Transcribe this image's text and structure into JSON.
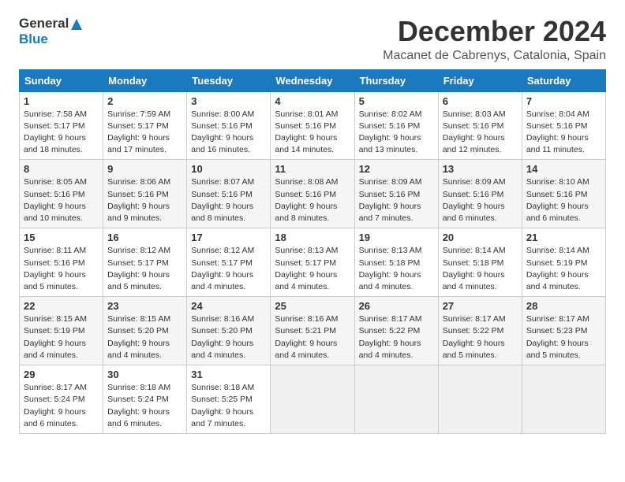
{
  "logo": {
    "line1": "General",
    "line2": "Blue"
  },
  "title": "December 2024",
  "subtitle": "Macanet de Cabrenys, Catalonia, Spain",
  "days_of_week": [
    "Sunday",
    "Monday",
    "Tuesday",
    "Wednesday",
    "Thursday",
    "Friday",
    "Saturday"
  ],
  "weeks": [
    [
      {
        "day": 1,
        "info": "Sunrise: 7:58 AM\nSunset: 5:17 PM\nDaylight: 9 hours and 18 minutes."
      },
      {
        "day": 2,
        "info": "Sunrise: 7:59 AM\nSunset: 5:17 PM\nDaylight: 9 hours and 17 minutes."
      },
      {
        "day": 3,
        "info": "Sunrise: 8:00 AM\nSunset: 5:16 PM\nDaylight: 9 hours and 16 minutes."
      },
      {
        "day": 4,
        "info": "Sunrise: 8:01 AM\nSunset: 5:16 PM\nDaylight: 9 hours and 14 minutes."
      },
      {
        "day": 5,
        "info": "Sunrise: 8:02 AM\nSunset: 5:16 PM\nDaylight: 9 hours and 13 minutes."
      },
      {
        "day": 6,
        "info": "Sunrise: 8:03 AM\nSunset: 5:16 PM\nDaylight: 9 hours and 12 minutes."
      },
      {
        "day": 7,
        "info": "Sunrise: 8:04 AM\nSunset: 5:16 PM\nDaylight: 9 hours and 11 minutes."
      }
    ],
    [
      {
        "day": 8,
        "info": "Sunrise: 8:05 AM\nSunset: 5:16 PM\nDaylight: 9 hours and 10 minutes."
      },
      {
        "day": 9,
        "info": "Sunrise: 8:06 AM\nSunset: 5:16 PM\nDaylight: 9 hours and 9 minutes."
      },
      {
        "day": 10,
        "info": "Sunrise: 8:07 AM\nSunset: 5:16 PM\nDaylight: 9 hours and 8 minutes."
      },
      {
        "day": 11,
        "info": "Sunrise: 8:08 AM\nSunset: 5:16 PM\nDaylight: 9 hours and 8 minutes."
      },
      {
        "day": 12,
        "info": "Sunrise: 8:09 AM\nSunset: 5:16 PM\nDaylight: 9 hours and 7 minutes."
      },
      {
        "day": 13,
        "info": "Sunrise: 8:09 AM\nSunset: 5:16 PM\nDaylight: 9 hours and 6 minutes."
      },
      {
        "day": 14,
        "info": "Sunrise: 8:10 AM\nSunset: 5:16 PM\nDaylight: 9 hours and 6 minutes."
      }
    ],
    [
      {
        "day": 15,
        "info": "Sunrise: 8:11 AM\nSunset: 5:16 PM\nDaylight: 9 hours and 5 minutes."
      },
      {
        "day": 16,
        "info": "Sunrise: 8:12 AM\nSunset: 5:17 PM\nDaylight: 9 hours and 5 minutes."
      },
      {
        "day": 17,
        "info": "Sunrise: 8:12 AM\nSunset: 5:17 PM\nDaylight: 9 hours and 4 minutes."
      },
      {
        "day": 18,
        "info": "Sunrise: 8:13 AM\nSunset: 5:17 PM\nDaylight: 9 hours and 4 minutes."
      },
      {
        "day": 19,
        "info": "Sunrise: 8:13 AM\nSunset: 5:18 PM\nDaylight: 9 hours and 4 minutes."
      },
      {
        "day": 20,
        "info": "Sunrise: 8:14 AM\nSunset: 5:18 PM\nDaylight: 9 hours and 4 minutes."
      },
      {
        "day": 21,
        "info": "Sunrise: 8:14 AM\nSunset: 5:19 PM\nDaylight: 9 hours and 4 minutes."
      }
    ],
    [
      {
        "day": 22,
        "info": "Sunrise: 8:15 AM\nSunset: 5:19 PM\nDaylight: 9 hours and 4 minutes."
      },
      {
        "day": 23,
        "info": "Sunrise: 8:15 AM\nSunset: 5:20 PM\nDaylight: 9 hours and 4 minutes."
      },
      {
        "day": 24,
        "info": "Sunrise: 8:16 AM\nSunset: 5:20 PM\nDaylight: 9 hours and 4 minutes."
      },
      {
        "day": 25,
        "info": "Sunrise: 8:16 AM\nSunset: 5:21 PM\nDaylight: 9 hours and 4 minutes."
      },
      {
        "day": 26,
        "info": "Sunrise: 8:17 AM\nSunset: 5:22 PM\nDaylight: 9 hours and 4 minutes."
      },
      {
        "day": 27,
        "info": "Sunrise: 8:17 AM\nSunset: 5:22 PM\nDaylight: 9 hours and 5 minutes."
      },
      {
        "day": 28,
        "info": "Sunrise: 8:17 AM\nSunset: 5:23 PM\nDaylight: 9 hours and 5 minutes."
      }
    ],
    [
      {
        "day": 29,
        "info": "Sunrise: 8:17 AM\nSunset: 5:24 PM\nDaylight: 9 hours and 6 minutes."
      },
      {
        "day": 30,
        "info": "Sunrise: 8:18 AM\nSunset: 5:24 PM\nDaylight: 9 hours and 6 minutes."
      },
      {
        "day": 31,
        "info": "Sunrise: 8:18 AM\nSunset: 5:25 PM\nDaylight: 9 hours and 7 minutes."
      },
      null,
      null,
      null,
      null
    ]
  ]
}
